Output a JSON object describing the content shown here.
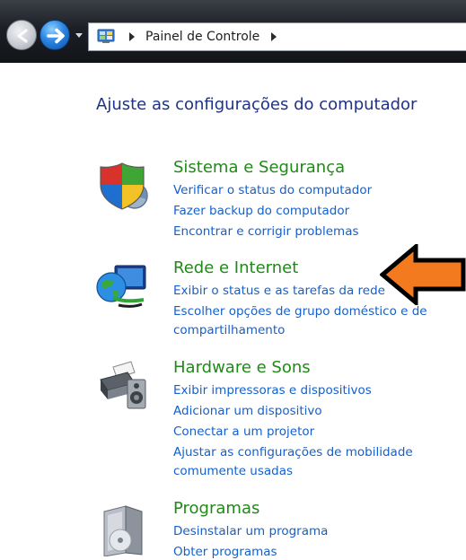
{
  "address_bar": {
    "breadcrumb": "Painel de Controle"
  },
  "page_title": "Ajuste as configurações do computador",
  "categories": [
    {
      "title": "Sistema e Segurança",
      "icon": "shield-icon",
      "links": [
        "Verificar o status do computador",
        "Fazer backup do computador",
        "Encontrar e corrigir problemas"
      ]
    },
    {
      "title": "Rede e Internet",
      "icon": "network-globe-icon",
      "links": [
        "Exibir o status e as tarefas da rede",
        "Escolher opções de grupo doméstico e de",
        "compartilhamento"
      ]
    },
    {
      "title": "Hardware e Sons",
      "icon": "printer-speaker-icon",
      "links": [
        "Exibir impressoras e dispositivos",
        "Adicionar um dispositivo",
        "Conectar a um projetor",
        "Ajustar as configurações de mobilidade",
        "comumente usadas"
      ]
    },
    {
      "title": "Programas",
      "icon": "programs-box-icon",
      "links": [
        "Desinstalar um programa",
        "Obter programas"
      ]
    }
  ],
  "colors": {
    "title": "#1e3287",
    "category_title": "#1f8a16",
    "link": "#1560cc",
    "annotation_arrow": "#f47a20"
  }
}
